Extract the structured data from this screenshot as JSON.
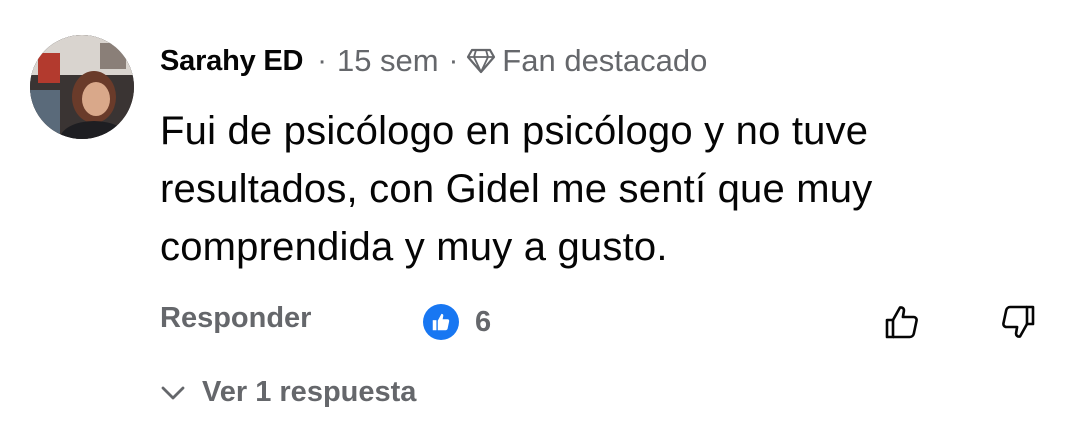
{
  "comment": {
    "author": "Sarahy ED",
    "separator": "·",
    "time": "15 sem",
    "badge_label": "Fan destacado",
    "badge_icon": "diamond-icon",
    "text": "Fui de psicólogo en psicólogo y no tuve resultados, con Gidel me sentí que muy comprendida y muy a gusto.",
    "reply_label": "Responder",
    "reaction_icon": "like-icon",
    "reaction_count": "6",
    "reaction_color": "#1877f2",
    "view_replies_label": "Ver 1 respuesta"
  },
  "colors": {
    "text_primary": "#050505",
    "text_secondary": "#65676b",
    "background": "#ffffff"
  }
}
